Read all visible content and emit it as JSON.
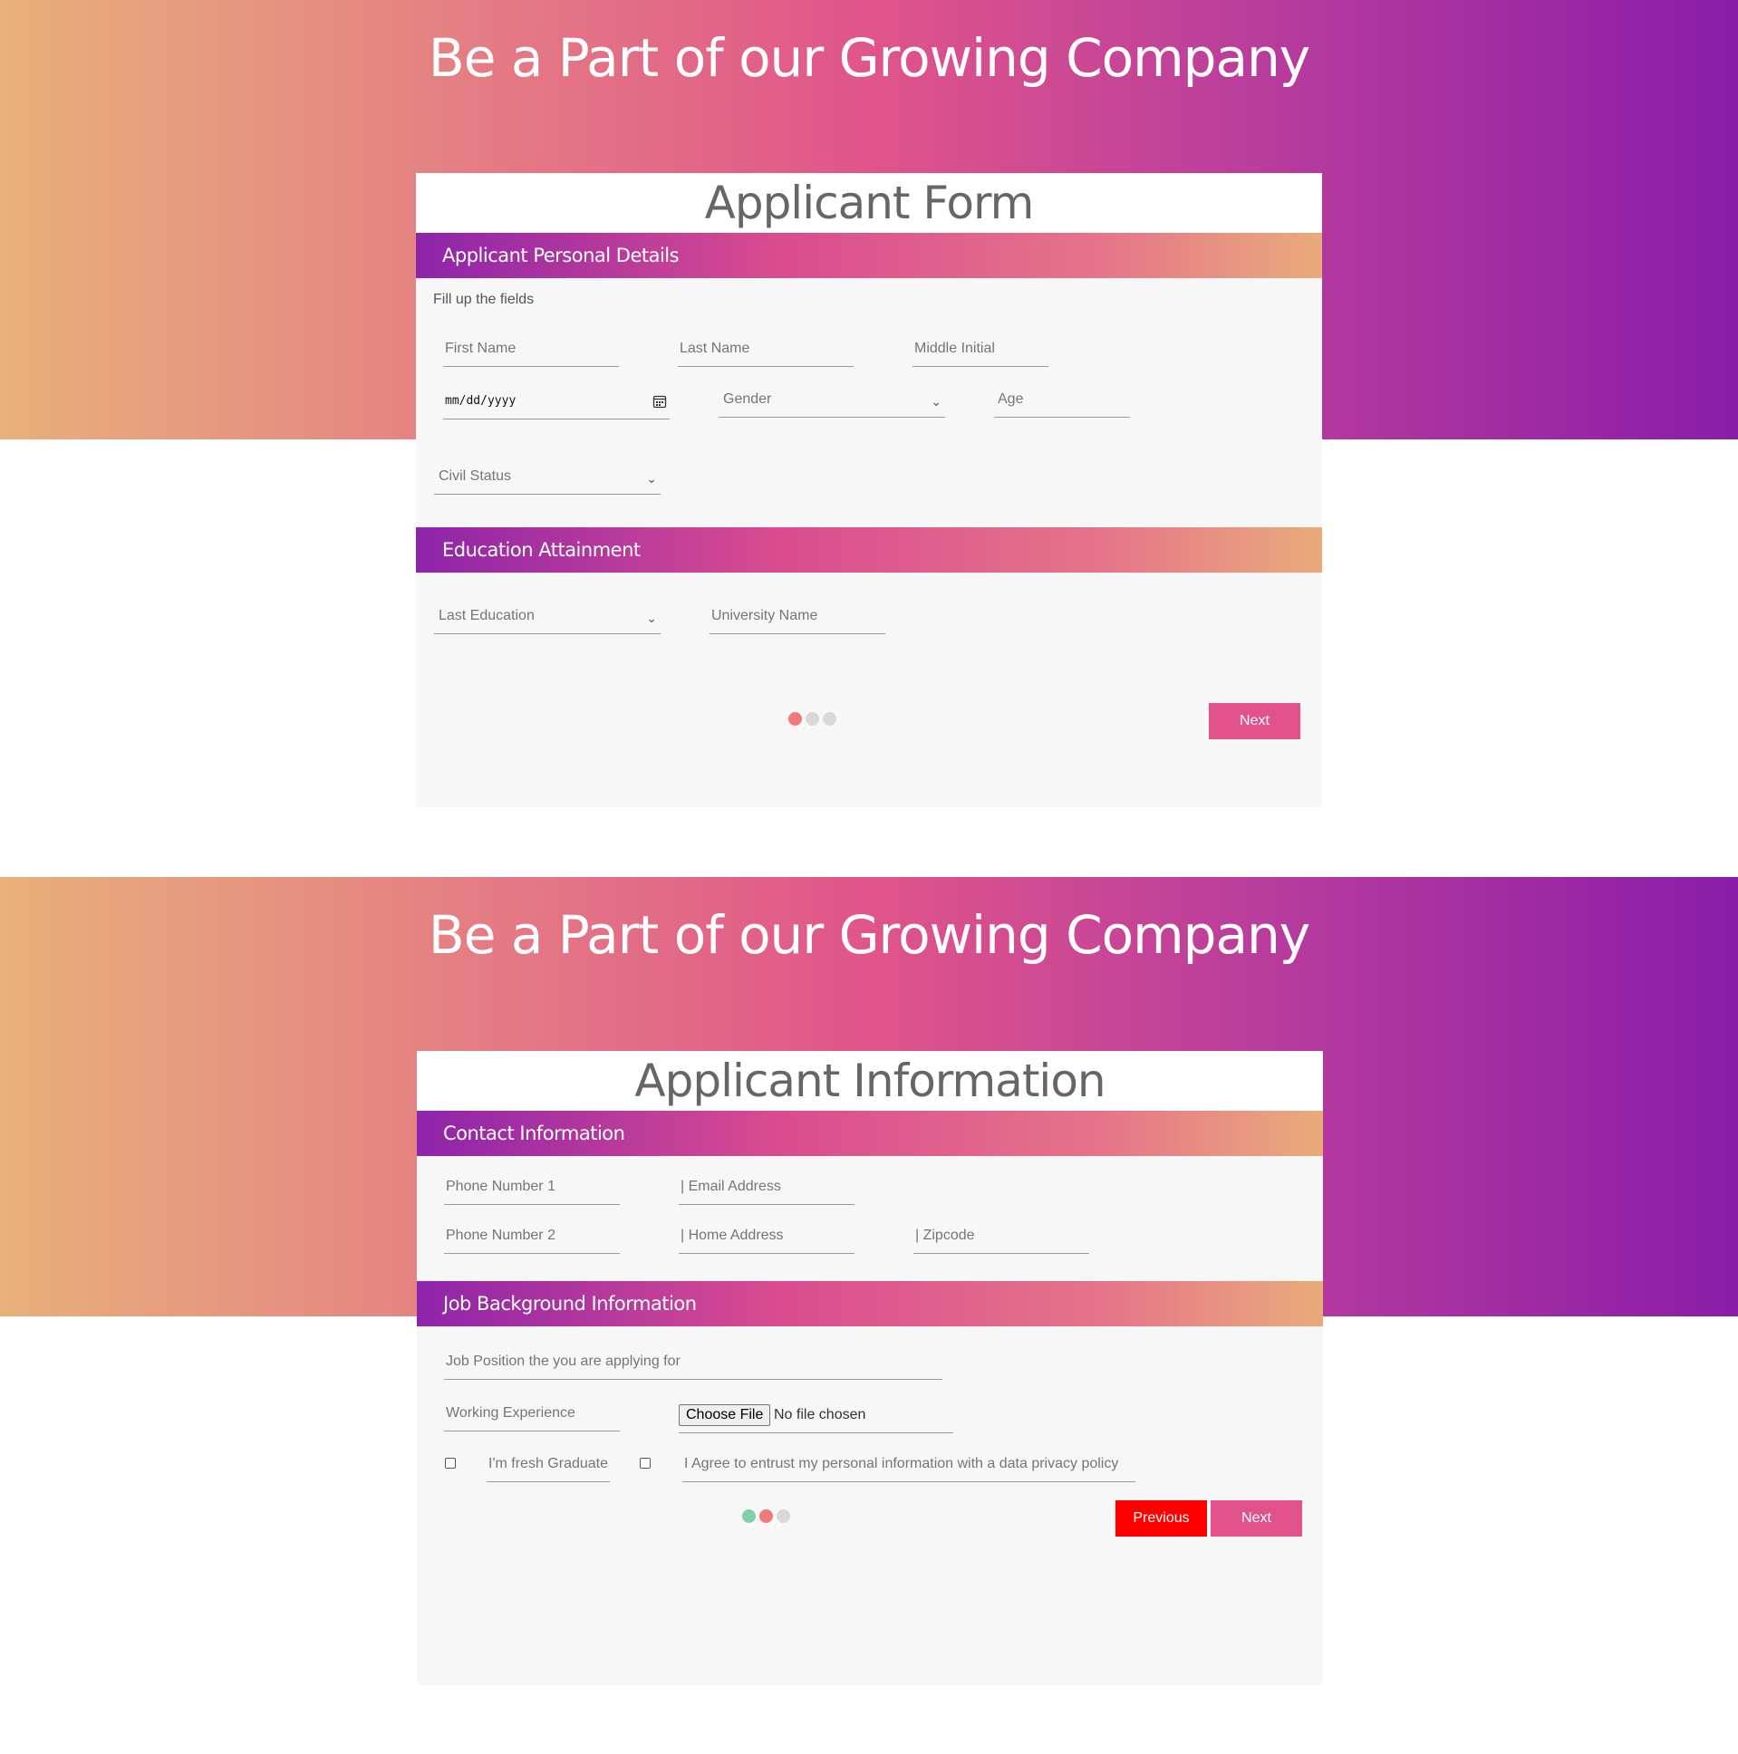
{
  "page_a": {
    "hero_title": "Be a Part of our Growing Company",
    "card_title": "Applicant Form",
    "personal_section": "Applicant Personal Details",
    "fill_note": "Fill up the fields",
    "fields": {
      "first_name": "First Name",
      "last_name": "Last Name",
      "middle_initial": "Middle Initial",
      "date": "mm/dd/yyyy",
      "gender": "Gender",
      "age": "Age",
      "civil_status": "Civil Status"
    },
    "education_section": "Education Attainment",
    "education": {
      "last_education": "Last Education",
      "university_name": "University Name"
    },
    "step_dots": [
      "#f07a7a",
      "#d9d9d9",
      "#d9d9d9"
    ],
    "next_label": "Next"
  },
  "page_b": {
    "hero_title": "Be a Part of our Growing Company",
    "card_title": "Applicant Information",
    "contact_section": "Contact Information",
    "contact": {
      "phone1": "Phone Number 1",
      "email": "| Email Address",
      "phone2": "Phone Number 2",
      "home_address": "| Home Address",
      "zipcode": "| Zipcode"
    },
    "job_section": "Job Background Information",
    "job": {
      "position": "Job Position the you are applying for",
      "experience": "Working Experience",
      "file_button": "Choose File",
      "file_status": "No file chosen",
      "fresh_graduate": "I'm fresh Graduate",
      "privacy_agree": "I Agree to entrust my personal information with a data privacy policy"
    },
    "step_dots": [
      "#7fcfa8",
      "#f07a7a",
      "#d9d9d9"
    ],
    "previous_label": "Previous",
    "next_label": "Next"
  },
  "colors": {
    "next_button": "#e05289",
    "previous_button": "#ff0000"
  }
}
